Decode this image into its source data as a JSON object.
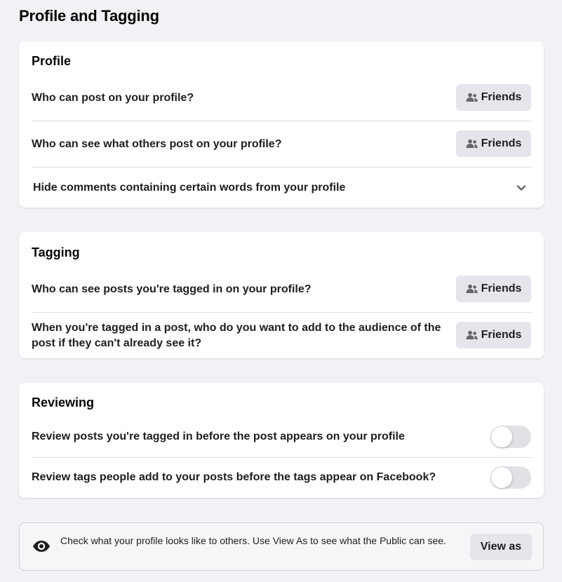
{
  "page": {
    "title": "Profile and Tagging"
  },
  "profile": {
    "title": "Profile",
    "rows": [
      {
        "label": "Who can post on your profile?",
        "audience": "Friends"
      },
      {
        "label": "Who can see what others post on your profile?",
        "audience": "Friends"
      }
    ],
    "hide_comments": {
      "label": "Hide comments containing certain words from your profile",
      "icon": "chevron-down-icon"
    }
  },
  "tagging": {
    "title": "Tagging",
    "rows": [
      {
        "label": "Who can see posts you're tagged in on your profile?",
        "audience": "Friends"
      },
      {
        "label": "When you're tagged in a post, who do you want to add to the audience of the post if they can't already see it?",
        "audience": "Friends"
      }
    ]
  },
  "reviewing": {
    "title": "Reviewing",
    "rows": [
      {
        "label": "Review posts you're tagged in before the post appears on your profile",
        "enabled": false
      },
      {
        "label": "Review tags people add to your posts before the tags appear on Facebook?",
        "enabled": false
      }
    ]
  },
  "view_as": {
    "icon": "eye-icon",
    "text": "Check what your profile looks like to others. Use View As to see what the Public can see.",
    "button_label": "View as"
  },
  "colors": {
    "background": "#f0f2f5",
    "card": "#ffffff",
    "button": "#e4e6eb",
    "toggle_off": "#dfe1e5",
    "text": "#1c1e21"
  }
}
